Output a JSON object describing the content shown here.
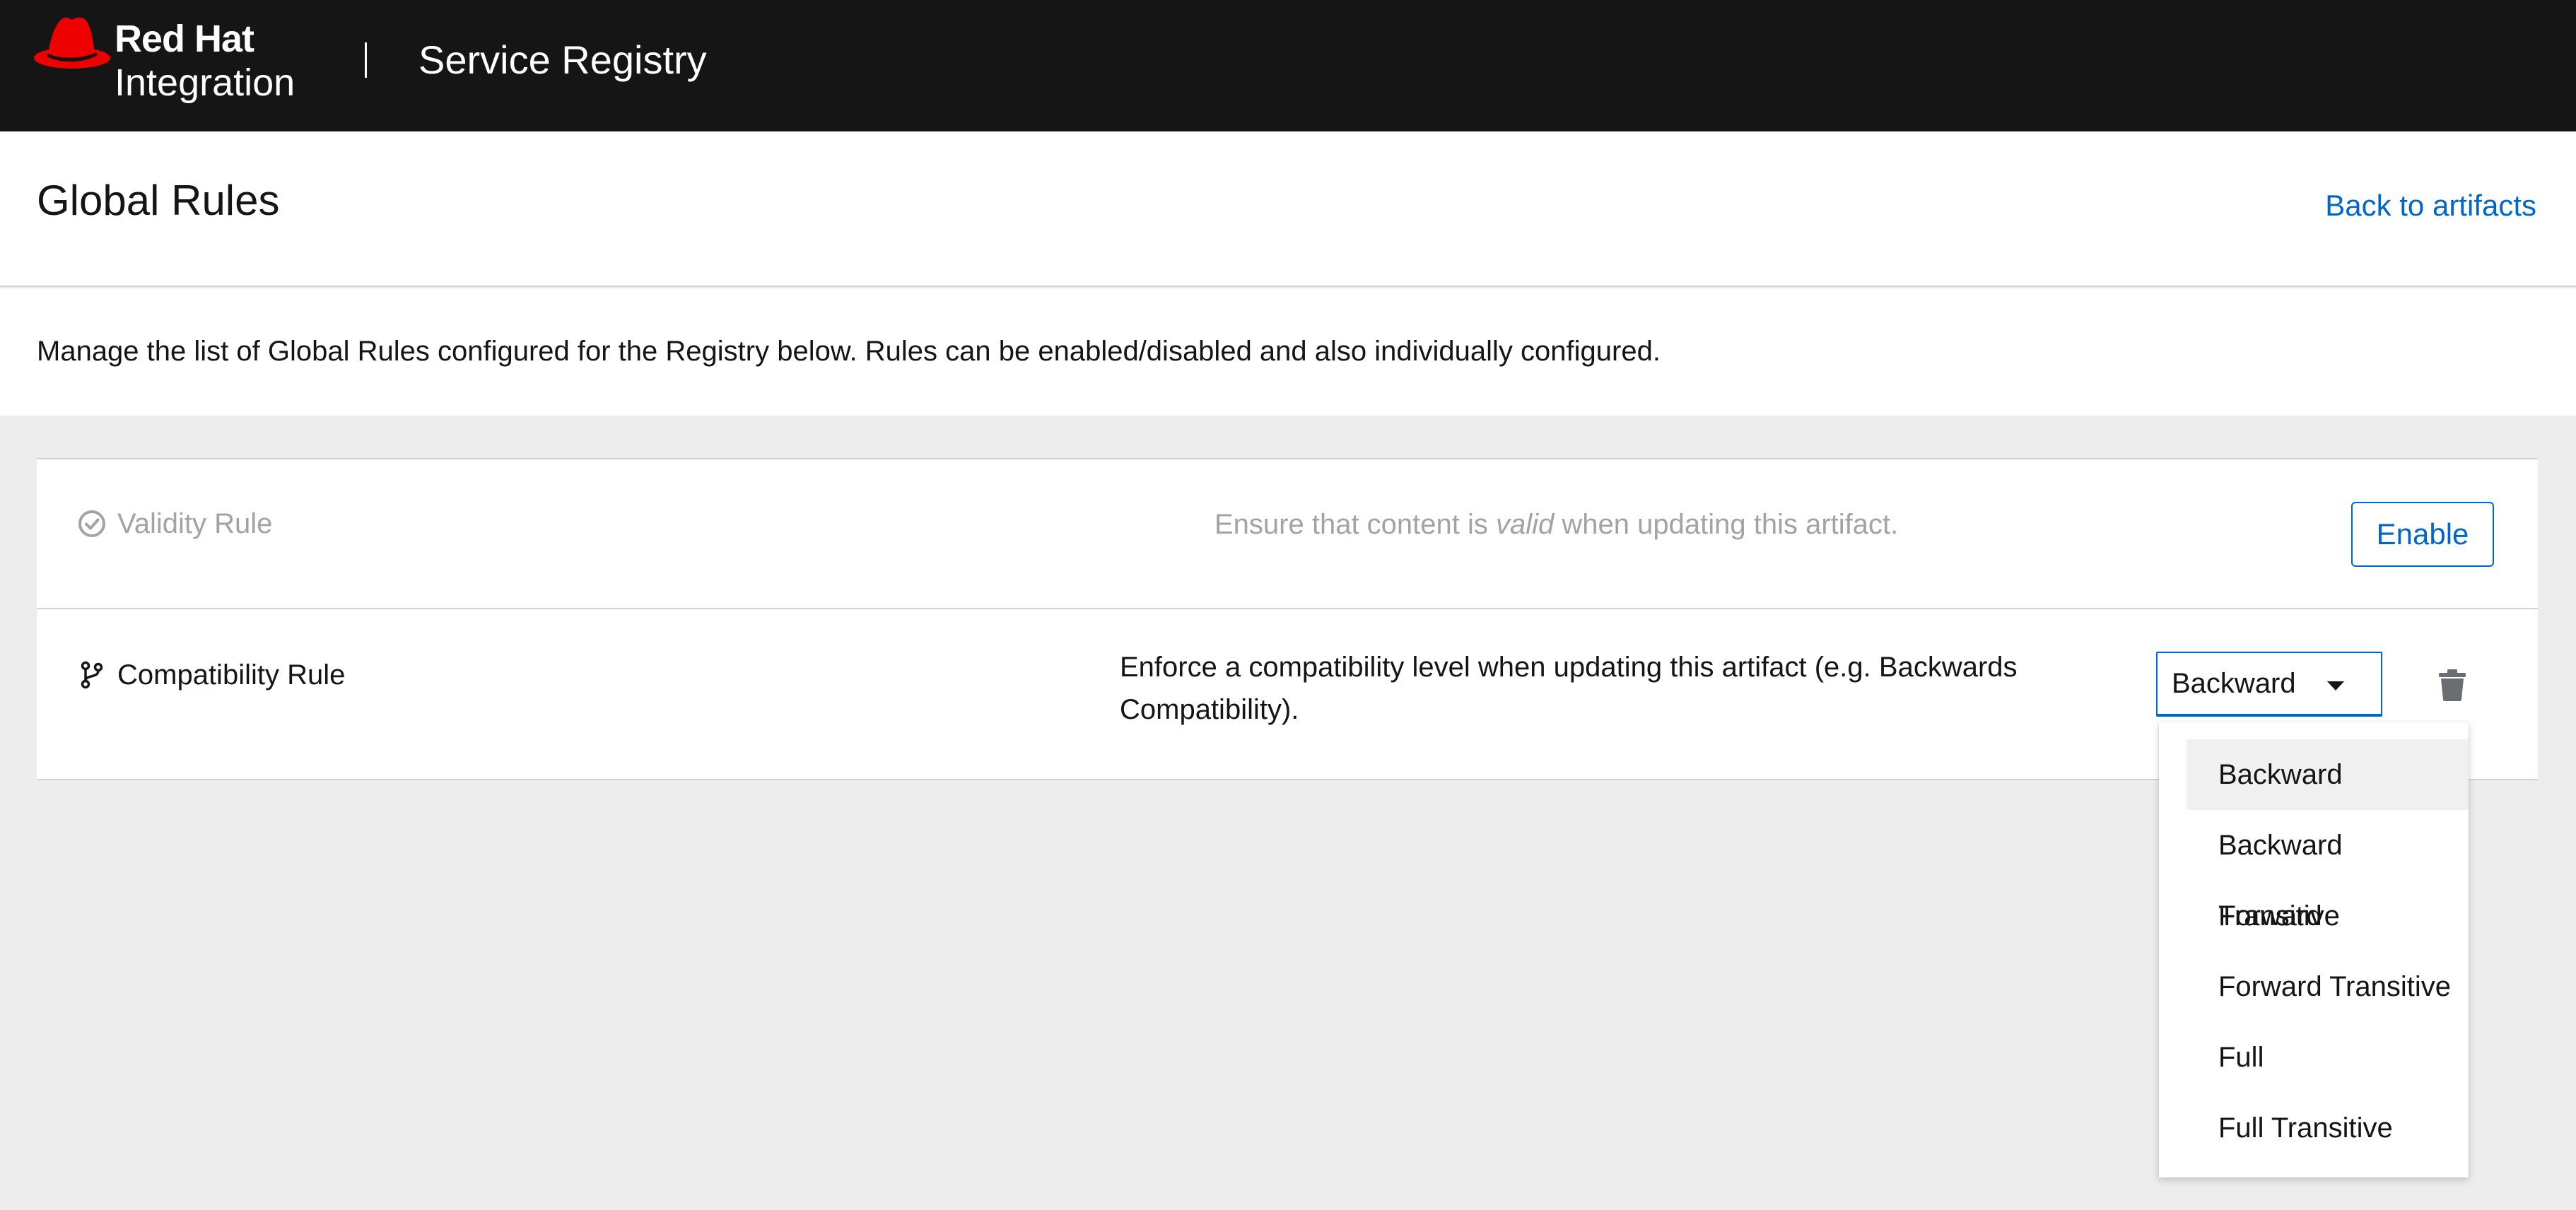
{
  "masthead": {
    "brand_line1": "Red Hat",
    "brand_line2": "Integration",
    "product_name": "Service Registry"
  },
  "header": {
    "title": "Global Rules",
    "back_link": "Back to artifacts"
  },
  "description": "Manage the list of Global Rules configured for the Registry below. Rules can be enabled/disabled and also individually configured.",
  "rules": {
    "validity": {
      "name": "Validity Rule",
      "desc_before": "Ensure that content is ",
      "desc_emph": "valid",
      "desc_after": " when updating this artifact.",
      "action_label": "Enable",
      "enabled": false
    },
    "compatibility": {
      "name": "Compatibility Rule",
      "description": "Enforce a compatibility level when updating this artifact (e.g. Backwards Compatibility).",
      "selected": "Backward",
      "enabled": true
    }
  },
  "dropdown": {
    "options": [
      "Backward",
      "Backward Transitive",
      "Forward",
      "Forward Transitive",
      "Full",
      "Full Transitive"
    ],
    "highlighted": "Backward"
  },
  "icons": {
    "logo": "red-hat-logo-icon",
    "validity": "check-circle-icon",
    "compatibility": "code-branch-icon",
    "delete": "trash-icon",
    "select": "caret-down-icon"
  },
  "colors": {
    "masthead_bg": "#151515",
    "link": "#0066cc",
    "brand_red": "#ee0000",
    "disabled_text": "#a3a3a3",
    "page_bg": "#ededed"
  }
}
